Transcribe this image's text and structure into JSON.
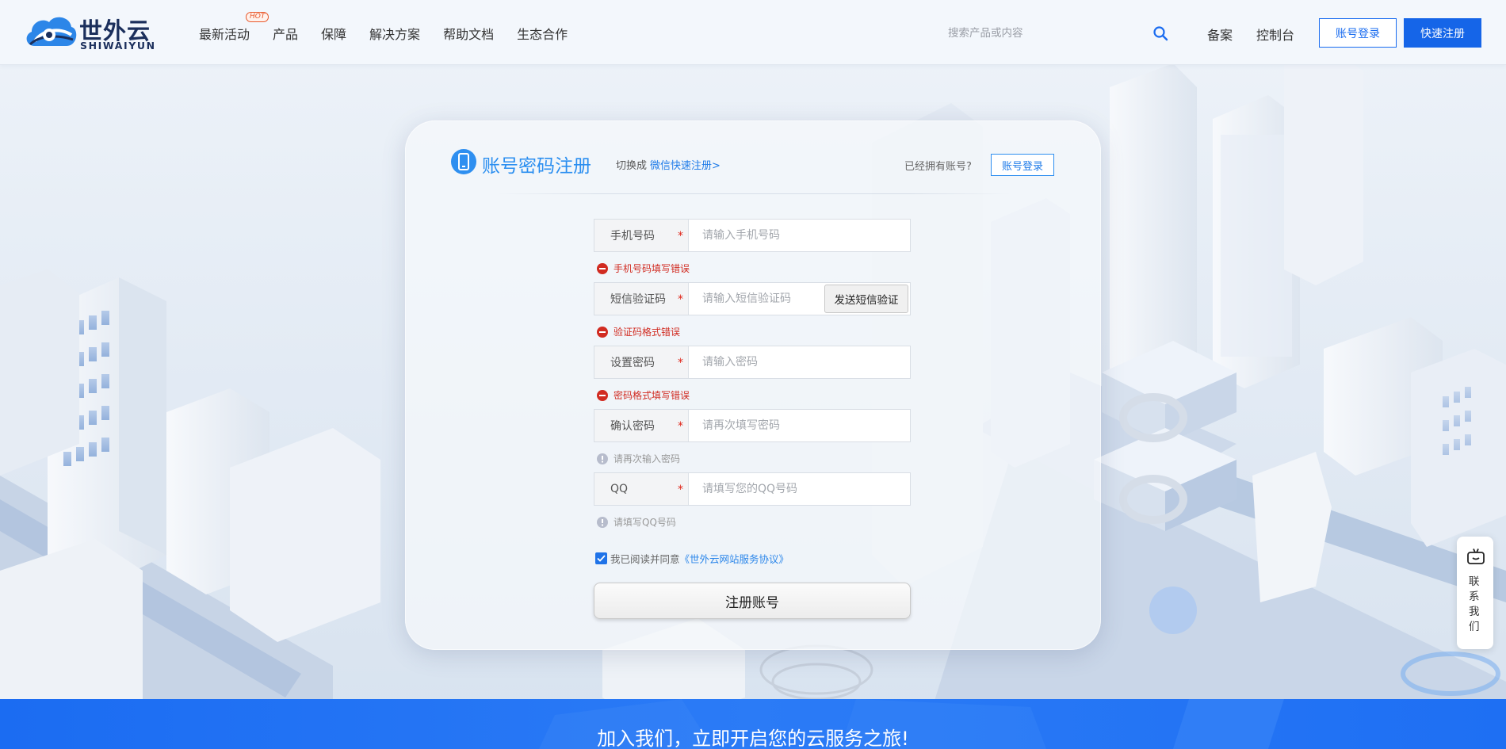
{
  "brand": {
    "name_cn": "世外云",
    "name_en": "SHIWAIYUN"
  },
  "nav": {
    "items": [
      {
        "label": "最新活动",
        "badge": "HOT"
      },
      {
        "label": "产品"
      },
      {
        "label": "保障"
      },
      {
        "label": "解决方案"
      },
      {
        "label": "帮助文档"
      },
      {
        "label": "生态合作"
      }
    ]
  },
  "search": {
    "placeholder": "搜索产品或内容",
    "icon": "search-icon"
  },
  "header_links": {
    "beian": "备案",
    "console": "控制台"
  },
  "header_buttons": {
    "login": "账号登录",
    "register": "快速注册"
  },
  "register": {
    "title": "账号密码注册",
    "switch_prefix": "切换成",
    "switch_link": "微信快速注册>",
    "have_account": "已经拥有账号?",
    "login_button": "账号登录",
    "fields": [
      {
        "label": "手机号码",
        "placeholder": "请输入手机号码",
        "message": "手机号码填写错误",
        "message_type": "error"
      },
      {
        "label": "短信验证码",
        "placeholder": "请输入短信验证码",
        "message": "验证码格式错误",
        "message_type": "error",
        "button": "发送短信验证"
      },
      {
        "label": "设置密码",
        "placeholder": "请输入密码",
        "message": "密码格式填写错误",
        "message_type": "error"
      },
      {
        "label": "确认密码",
        "placeholder": "请再次填写密码",
        "message": "请再次输入密码",
        "message_type": "info"
      },
      {
        "label": "QQ",
        "placeholder": "请填写您的QQ号码",
        "message": "请填写QQ号码",
        "message_type": "info"
      }
    ],
    "required_mark": "*",
    "agree_text": "我已阅读并同意",
    "agree_link": "《世外云网站服务协议》",
    "agree_checked": true,
    "submit": "注册账号"
  },
  "contact": {
    "label": "联系我们"
  },
  "banner": {
    "text": "加入我们，立即开启您的云服务之旅!"
  },
  "colors": {
    "accent": "#1565e8",
    "title_blue": "#2a8ef0",
    "error": "#d12b21",
    "banner": "#1b6cf2"
  }
}
